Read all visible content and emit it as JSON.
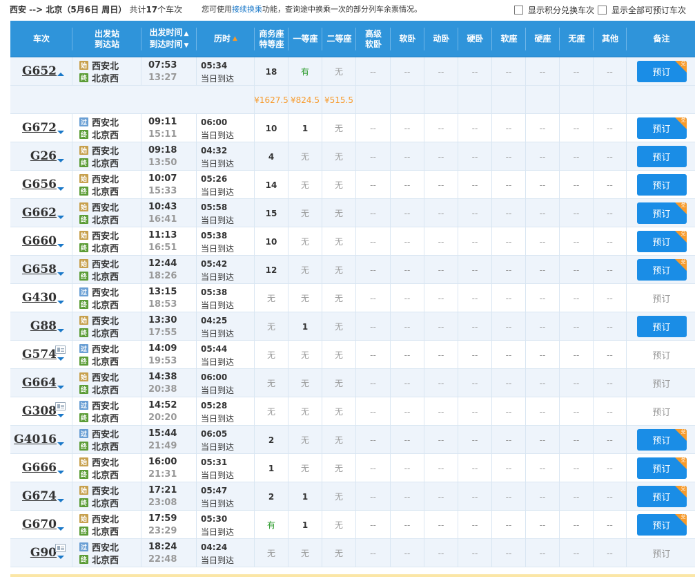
{
  "header": {
    "route": "西安 --> 北京（5月6日  周日）",
    "count_prefix": "共计",
    "count": "17",
    "count_suffix": "个车次",
    "hint_prefix": "您可使用",
    "hint_link": "接续换乘",
    "hint_suffix": "功能，查询途中换乘一次的部分列车余票情况。",
    "opt_points": "显示积分兑换车次",
    "opt_all": "显示全部可预订车次"
  },
  "columns": {
    "train": "车次",
    "station_from": "出发站",
    "station_to": "到达站",
    "time_dep": "出发时间",
    "time_arr": "到达时间",
    "duration": "历时",
    "business": [
      "商务座",
      "特等座"
    ],
    "first": "一等座",
    "second": "二等座",
    "premium_soft": [
      "高级",
      "软卧"
    ],
    "soft_sleeper": "软卧",
    "moving_sleeper": "动卧",
    "hard_sleeper": "硬卧",
    "soft_seat": "软座",
    "hard_seat": "硬座",
    "no_seat": "无座",
    "other": "其他",
    "remark": "备注"
  },
  "book_label": "预订",
  "exchange_mark": "兑",
  "same_day": "当日到达",
  "badges": {
    "start": "始",
    "pass": "过",
    "end": "终"
  },
  "price_row": {
    "business": "¥1627.5",
    "first": "¥824.5",
    "second": "¥515.5"
  },
  "trains": [
    {
      "no": "G652",
      "from_badge": "始",
      "from": "西安北",
      "to": "北京西",
      "dep": "07:53",
      "arr": "13:27",
      "dur": "05:34",
      "biz": "18",
      "first": "有",
      "second": "无",
      "bookable": true,
      "exchange": true,
      "expanded": true,
      "idcard": false
    },
    {
      "no": "G672",
      "from_badge": "过",
      "from": "西安北",
      "to": "北京西",
      "dep": "09:11",
      "arr": "15:11",
      "dur": "06:00",
      "biz": "10",
      "first": "1",
      "second": "无",
      "bookable": true,
      "exchange": true,
      "idcard": false
    },
    {
      "no": "G26",
      "from_badge": "始",
      "from": "西安北",
      "to": "北京西",
      "dep": "09:18",
      "arr": "13:50",
      "dur": "04:32",
      "biz": "4",
      "first": "无",
      "second": "无",
      "bookable": true,
      "exchange": false,
      "idcard": false
    },
    {
      "no": "G656",
      "from_badge": "始",
      "from": "西安北",
      "to": "北京西",
      "dep": "10:07",
      "arr": "15:33",
      "dur": "05:26",
      "biz": "14",
      "first": "无",
      "second": "无",
      "bookable": true,
      "exchange": false,
      "idcard": false
    },
    {
      "no": "G662",
      "from_badge": "始",
      "from": "西安北",
      "to": "北京西",
      "dep": "10:43",
      "arr": "16:41",
      "dur": "05:58",
      "biz": "15",
      "first": "无",
      "second": "无",
      "bookable": true,
      "exchange": true,
      "idcard": false
    },
    {
      "no": "G660",
      "from_badge": "始",
      "from": "西安北",
      "to": "北京西",
      "dep": "11:13",
      "arr": "16:51",
      "dur": "05:38",
      "biz": "10",
      "first": "无",
      "second": "无",
      "bookable": true,
      "exchange": true,
      "idcard": false
    },
    {
      "no": "G658",
      "from_badge": "始",
      "from": "西安北",
      "to": "北京西",
      "dep": "12:44",
      "arr": "18:26",
      "dur": "05:42",
      "biz": "12",
      "first": "无",
      "second": "无",
      "bookable": true,
      "exchange": true,
      "idcard": false
    },
    {
      "no": "G430",
      "from_badge": "过",
      "from": "西安北",
      "to": "北京西",
      "dep": "13:15",
      "arr": "18:53",
      "dur": "05:38",
      "biz": "无",
      "first": "无",
      "second": "无",
      "bookable": false,
      "exchange": false,
      "idcard": false
    },
    {
      "no": "G88",
      "from_badge": "始",
      "from": "西安北",
      "to": "北京西",
      "dep": "13:30",
      "arr": "17:55",
      "dur": "04:25",
      "biz": "无",
      "first": "1",
      "second": "无",
      "bookable": true,
      "exchange": false,
      "idcard": false
    },
    {
      "no": "G574",
      "from_badge": "过",
      "from": "西安北",
      "to": "北京西",
      "dep": "14:09",
      "arr": "19:53",
      "dur": "05:44",
      "biz": "无",
      "first": "无",
      "second": "无",
      "bookable": false,
      "exchange": false,
      "idcard": true
    },
    {
      "no": "G664",
      "from_badge": "始",
      "from": "西安北",
      "to": "北京西",
      "dep": "14:38",
      "arr": "20:38",
      "dur": "06:00",
      "biz": "无",
      "first": "无",
      "second": "无",
      "bookable": false,
      "exchange": false,
      "idcard": false
    },
    {
      "no": "G308",
      "from_badge": "过",
      "from": "西安北",
      "to": "北京西",
      "dep": "14:52",
      "arr": "20:20",
      "dur": "05:28",
      "biz": "无",
      "first": "无",
      "second": "无",
      "bookable": false,
      "exchange": false,
      "idcard": true
    },
    {
      "no": "G4016",
      "from_badge": "过",
      "from": "西安北",
      "to": "北京西",
      "dep": "15:44",
      "arr": "21:49",
      "dur": "06:05",
      "biz": "2",
      "first": "无",
      "second": "无",
      "bookable": true,
      "exchange": true,
      "idcard": false
    },
    {
      "no": "G666",
      "from_badge": "始",
      "from": "西安北",
      "to": "北京西",
      "dep": "16:00",
      "arr": "21:31",
      "dur": "05:31",
      "biz": "1",
      "first": "无",
      "second": "无",
      "bookable": true,
      "exchange": true,
      "idcard": false
    },
    {
      "no": "G674",
      "from_badge": "始",
      "from": "西安北",
      "to": "北京西",
      "dep": "17:21",
      "arr": "23:08",
      "dur": "05:47",
      "biz": "2",
      "first": "1",
      "second": "无",
      "bookable": true,
      "exchange": true,
      "idcard": false
    },
    {
      "no": "G670",
      "from_badge": "始",
      "from": "西安北",
      "to": "北京西",
      "dep": "17:59",
      "arr": "23:29",
      "dur": "05:30",
      "biz": "有",
      "first": "1",
      "second": "无",
      "bookable": true,
      "exchange": true,
      "idcard": false
    },
    {
      "no": "G90",
      "from_badge": "过",
      "from": "西安北",
      "to": "北京西",
      "dep": "18:24",
      "arr": "22:48",
      "dur": "04:24",
      "biz": "无",
      "first": "无",
      "second": "无",
      "bookable": false,
      "exchange": false,
      "idcard": true
    }
  ],
  "empty_mark": "--",
  "colors": {
    "header_blue": "#2f94da",
    "button_blue": "#1a8de6",
    "price_orange": "#f79a2a",
    "available_green": "#2c9b2c"
  }
}
